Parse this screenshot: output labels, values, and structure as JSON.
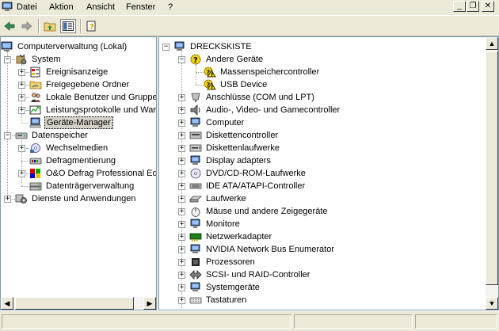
{
  "menubar": {
    "items": [
      {
        "label": "Datei"
      },
      {
        "label": "Aktion"
      },
      {
        "label": "Ansicht"
      },
      {
        "label": "Fenster"
      },
      {
        "label": "?"
      }
    ]
  },
  "window_controls": {
    "minimize": "_",
    "restore": "❐",
    "close": "✕"
  },
  "toolbar": {
    "buttons": [
      "back-arrow-icon",
      "forward-arrow-icon",
      "up-folder-icon",
      "show-hide-tree-icon",
      "help-properties-icon"
    ]
  },
  "left_tree": {
    "items": [
      {
        "label": "Computerverwaltung (Lokal)",
        "icon": "computer-management-icon"
      },
      {
        "label": "System",
        "icon": "system-tools-icon"
      },
      {
        "label": "Ereignisanzeige",
        "icon": "event-viewer-icon"
      },
      {
        "label": "Freigegebene Ordner",
        "icon": "shared-folder-icon"
      },
      {
        "label": "Lokale Benutzer und Gruppen",
        "icon": "users-groups-icon"
      },
      {
        "label": "Leistungsprotokolle und Warnungen",
        "icon": "performance-logs-icon"
      },
      {
        "label": "Geräte-Manager",
        "icon": "device-manager-icon",
        "selected": true
      },
      {
        "label": "Datenspeicher",
        "icon": "storage-icon"
      },
      {
        "label": "Wechselmedien",
        "icon": "removable-storage-icon"
      },
      {
        "label": "Defragmentierung",
        "icon": "defrag-icon"
      },
      {
        "label": "O&O Defrag Professional Edition",
        "icon": "oo-defrag-icon"
      },
      {
        "label": "Datenträgerverwaltung",
        "icon": "disk-management-icon"
      },
      {
        "label": "Dienste und Anwendungen",
        "icon": "services-icon"
      }
    ]
  },
  "right_tree": {
    "root": "DRECKSKISTE",
    "items": [
      {
        "label": "Andere Geräte"
      },
      {
        "label": "Massenspeichercontroller"
      },
      {
        "label": "USB Device"
      },
      {
        "label": "Anschlüsse (COM und LPT)"
      },
      {
        "label": "Audio-, Video- und Gamecontroller"
      },
      {
        "label": "Computer"
      },
      {
        "label": "Diskettencontroller"
      },
      {
        "label": "Diskettenlaufwerke"
      },
      {
        "label": "Display adapters"
      },
      {
        "label": "DVD/CD-ROM-Laufwerke"
      },
      {
        "label": "IDE ATA/ATAPI-Controller"
      },
      {
        "label": "Laufwerke"
      },
      {
        "label": "Mäuse und andere Zeigegeräte"
      },
      {
        "label": "Monitore"
      },
      {
        "label": "Netzwerkadapter"
      },
      {
        "label": "NVIDIA Network Bus Enumerator"
      },
      {
        "label": "Prozessoren"
      },
      {
        "label": "SCSI- und RAID-Controller"
      },
      {
        "label": "Systemgeräte"
      },
      {
        "label": "Tastaturen"
      }
    ]
  },
  "colors": {
    "accent": "#316ac5",
    "chrome": "#ece9d8",
    "warning": "#f5d800"
  }
}
